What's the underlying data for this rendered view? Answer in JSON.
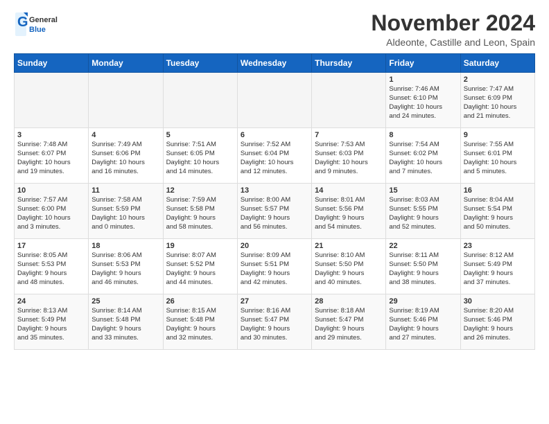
{
  "logo": {
    "text1": "General",
    "text2": "Blue"
  },
  "title": "November 2024",
  "subtitle": "Aldeonte, Castille and Leon, Spain",
  "weekdays": [
    "Sunday",
    "Monday",
    "Tuesday",
    "Wednesday",
    "Thursday",
    "Friday",
    "Saturday"
  ],
  "weeks": [
    [
      {
        "day": "",
        "info": ""
      },
      {
        "day": "",
        "info": ""
      },
      {
        "day": "",
        "info": ""
      },
      {
        "day": "",
        "info": ""
      },
      {
        "day": "",
        "info": ""
      },
      {
        "day": "1",
        "info": "Sunrise: 7:46 AM\nSunset: 6:10 PM\nDaylight: 10 hours\nand 24 minutes."
      },
      {
        "day": "2",
        "info": "Sunrise: 7:47 AM\nSunset: 6:09 PM\nDaylight: 10 hours\nand 21 minutes."
      }
    ],
    [
      {
        "day": "3",
        "info": "Sunrise: 7:48 AM\nSunset: 6:07 PM\nDaylight: 10 hours\nand 19 minutes."
      },
      {
        "day": "4",
        "info": "Sunrise: 7:49 AM\nSunset: 6:06 PM\nDaylight: 10 hours\nand 16 minutes."
      },
      {
        "day": "5",
        "info": "Sunrise: 7:51 AM\nSunset: 6:05 PM\nDaylight: 10 hours\nand 14 minutes."
      },
      {
        "day": "6",
        "info": "Sunrise: 7:52 AM\nSunset: 6:04 PM\nDaylight: 10 hours\nand 12 minutes."
      },
      {
        "day": "7",
        "info": "Sunrise: 7:53 AM\nSunset: 6:03 PM\nDaylight: 10 hours\nand 9 minutes."
      },
      {
        "day": "8",
        "info": "Sunrise: 7:54 AM\nSunset: 6:02 PM\nDaylight: 10 hours\nand 7 minutes."
      },
      {
        "day": "9",
        "info": "Sunrise: 7:55 AM\nSunset: 6:01 PM\nDaylight: 10 hours\nand 5 minutes."
      }
    ],
    [
      {
        "day": "10",
        "info": "Sunrise: 7:57 AM\nSunset: 6:00 PM\nDaylight: 10 hours\nand 3 minutes."
      },
      {
        "day": "11",
        "info": "Sunrise: 7:58 AM\nSunset: 5:59 PM\nDaylight: 10 hours\nand 0 minutes."
      },
      {
        "day": "12",
        "info": "Sunrise: 7:59 AM\nSunset: 5:58 PM\nDaylight: 9 hours\nand 58 minutes."
      },
      {
        "day": "13",
        "info": "Sunrise: 8:00 AM\nSunset: 5:57 PM\nDaylight: 9 hours\nand 56 minutes."
      },
      {
        "day": "14",
        "info": "Sunrise: 8:01 AM\nSunset: 5:56 PM\nDaylight: 9 hours\nand 54 minutes."
      },
      {
        "day": "15",
        "info": "Sunrise: 8:03 AM\nSunset: 5:55 PM\nDaylight: 9 hours\nand 52 minutes."
      },
      {
        "day": "16",
        "info": "Sunrise: 8:04 AM\nSunset: 5:54 PM\nDaylight: 9 hours\nand 50 minutes."
      }
    ],
    [
      {
        "day": "17",
        "info": "Sunrise: 8:05 AM\nSunset: 5:53 PM\nDaylight: 9 hours\nand 48 minutes."
      },
      {
        "day": "18",
        "info": "Sunrise: 8:06 AM\nSunset: 5:53 PM\nDaylight: 9 hours\nand 46 minutes."
      },
      {
        "day": "19",
        "info": "Sunrise: 8:07 AM\nSunset: 5:52 PM\nDaylight: 9 hours\nand 44 minutes."
      },
      {
        "day": "20",
        "info": "Sunrise: 8:09 AM\nSunset: 5:51 PM\nDaylight: 9 hours\nand 42 minutes."
      },
      {
        "day": "21",
        "info": "Sunrise: 8:10 AM\nSunset: 5:50 PM\nDaylight: 9 hours\nand 40 minutes."
      },
      {
        "day": "22",
        "info": "Sunrise: 8:11 AM\nSunset: 5:50 PM\nDaylight: 9 hours\nand 38 minutes."
      },
      {
        "day": "23",
        "info": "Sunrise: 8:12 AM\nSunset: 5:49 PM\nDaylight: 9 hours\nand 37 minutes."
      }
    ],
    [
      {
        "day": "24",
        "info": "Sunrise: 8:13 AM\nSunset: 5:49 PM\nDaylight: 9 hours\nand 35 minutes."
      },
      {
        "day": "25",
        "info": "Sunrise: 8:14 AM\nSunset: 5:48 PM\nDaylight: 9 hours\nand 33 minutes."
      },
      {
        "day": "26",
        "info": "Sunrise: 8:15 AM\nSunset: 5:48 PM\nDaylight: 9 hours\nand 32 minutes."
      },
      {
        "day": "27",
        "info": "Sunrise: 8:16 AM\nSunset: 5:47 PM\nDaylight: 9 hours\nand 30 minutes."
      },
      {
        "day": "28",
        "info": "Sunrise: 8:18 AM\nSunset: 5:47 PM\nDaylight: 9 hours\nand 29 minutes."
      },
      {
        "day": "29",
        "info": "Sunrise: 8:19 AM\nSunset: 5:46 PM\nDaylight: 9 hours\nand 27 minutes."
      },
      {
        "day": "30",
        "info": "Sunrise: 8:20 AM\nSunset: 5:46 PM\nDaylight: 9 hours\nand 26 minutes."
      }
    ]
  ]
}
